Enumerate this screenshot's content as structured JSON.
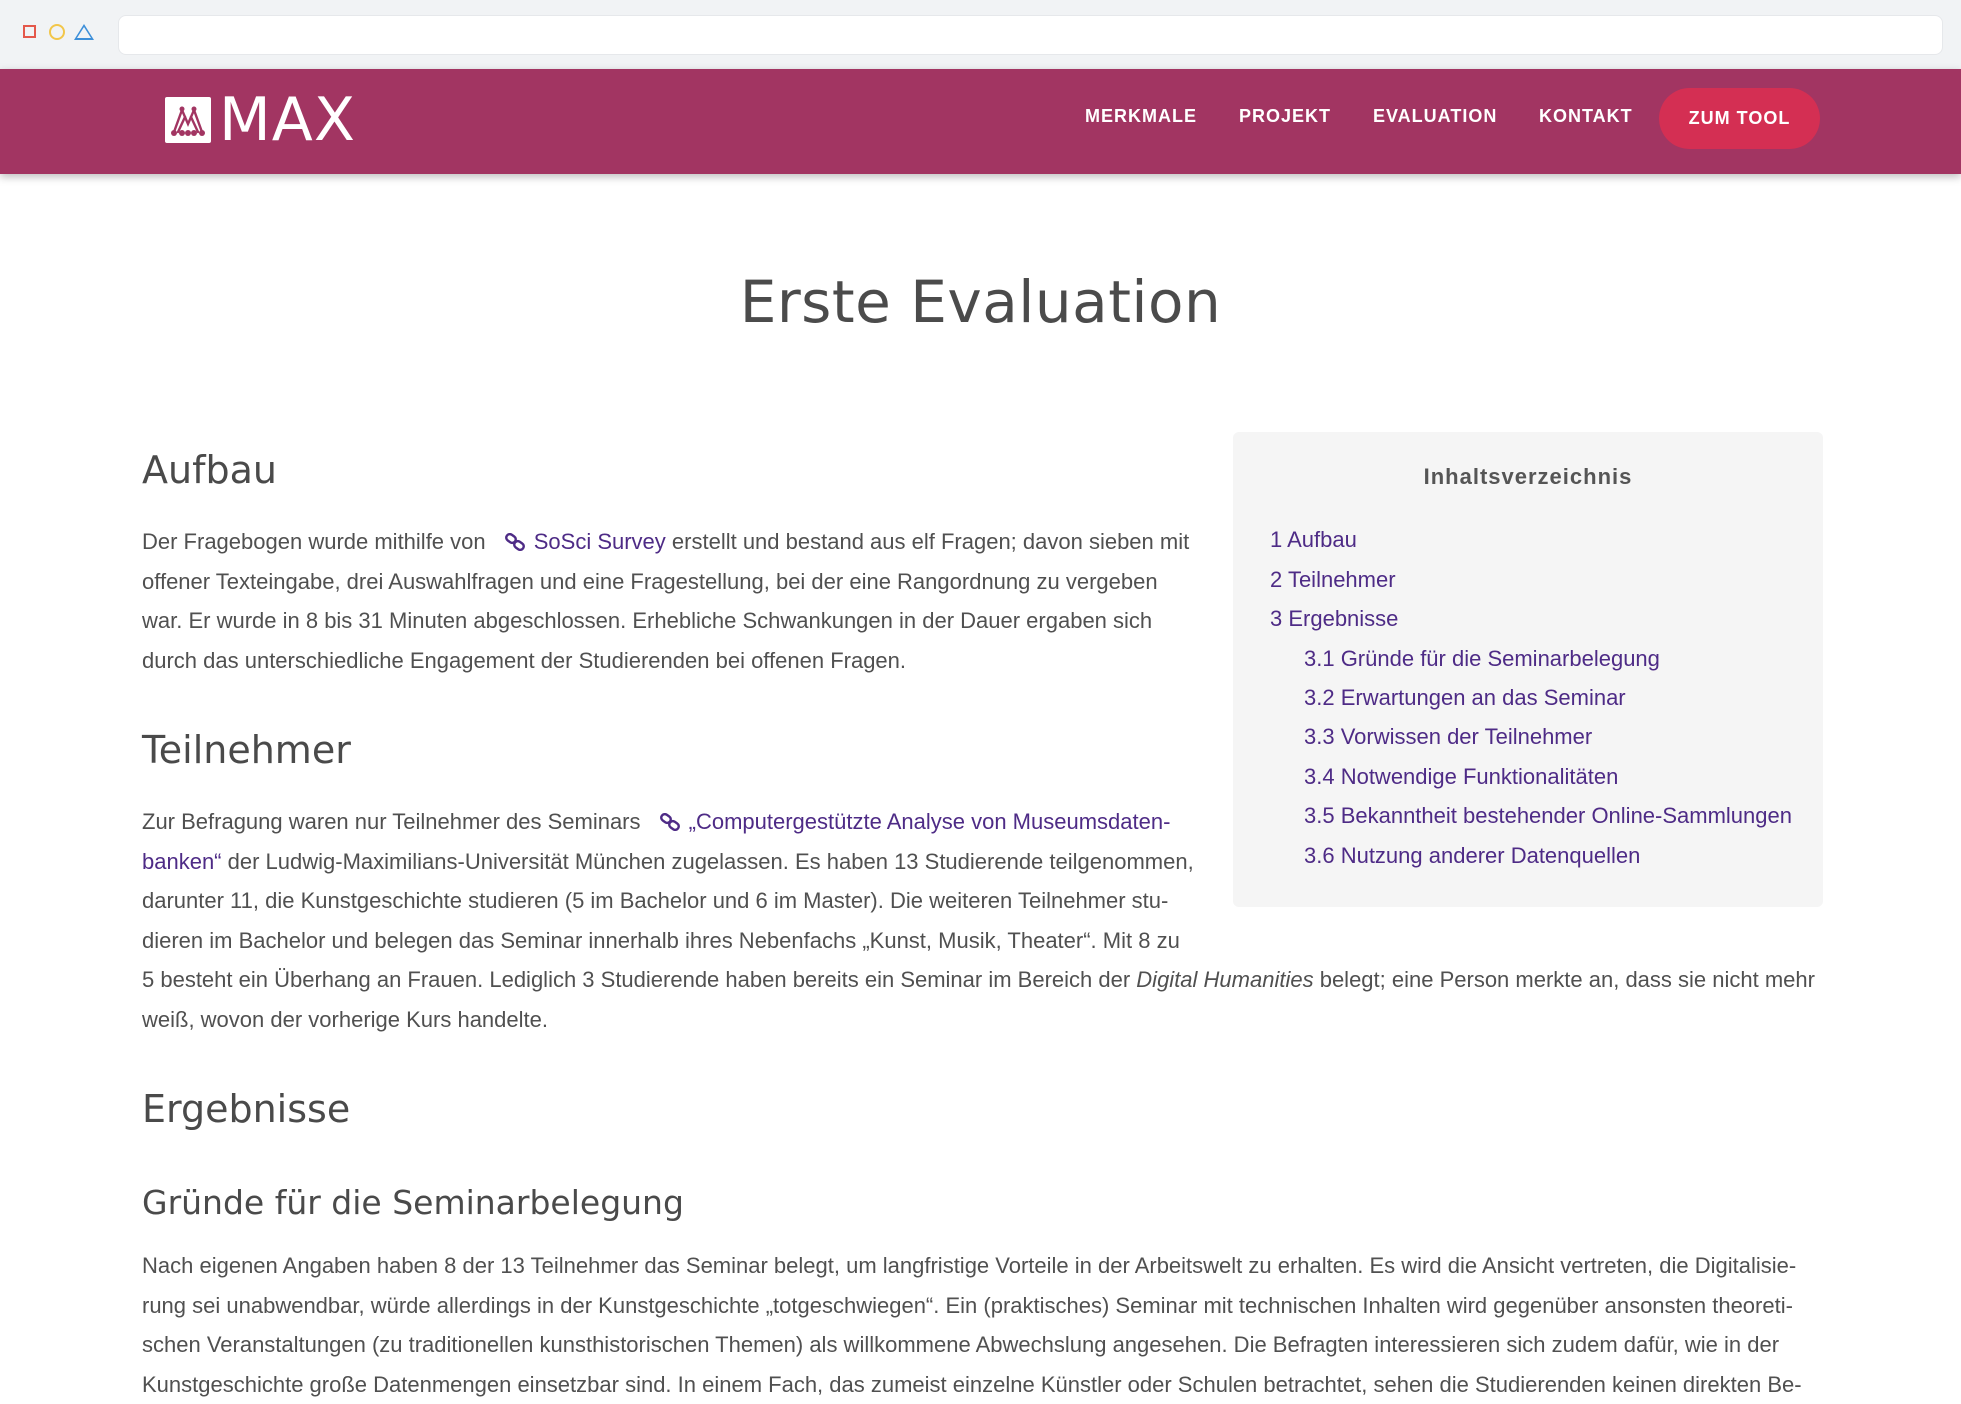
{
  "brand": {
    "name": "MAX",
    "primary_color": "#a23562",
    "cta_color": "#d42f53",
    "link_color": "#4e2b86"
  },
  "nav": {
    "items": [
      {
        "label": "MERKMALE"
      },
      {
        "label": "PROJEKT"
      },
      {
        "label": "EVALUATION"
      },
      {
        "label": "KONTAKT"
      }
    ],
    "cta_label": "ZUM TOOL"
  },
  "page": {
    "title": "Erste Evaluation"
  },
  "sections": {
    "aufbau": {
      "heading": "Aufbau",
      "text_before_link": "Der Fragebogen wurde mithilfe von ",
      "link": "SoSci Survey",
      "text_line1_after": " erstellt und bestand aus elf Fragen; davon sieben mit",
      "line2": "offener Texteingabe, drei Auswahlfragen und eine Fragestellung, bei der eine Rangordnung zu vergeben",
      "line3": "war. Er wurde in 8 bis 31 Minuten abgeschlossen. Erhebliche Schwankungen in der Dauer ergaben sich",
      "line4": "durch das unterschiedliche Engagement der Studierenden bei offenen Fragen."
    },
    "teilnehmer": {
      "heading": "Teilnehmer",
      "text_before_link": "Zur Befragung waren nur Teilnehmer des Seminars ",
      "link_line1": "„Computergestützte Analyse von Museumsdaten-",
      "link_line2": "banken“",
      "line2_after": " der Ludwig-Maximilians-Universität München zugelassen. Es haben 13 Studierende teilgenommen,",
      "line3": "darunter 11, die Kunstgeschichte studieren (5 im Bachelor und 6 im Master). Die weiteren Teilnehmer stu-",
      "line4": "dieren im Bachelor und belegen das Seminar innerhalb ihres Nebenfachs „Kunst, Musik, Theater“. Mit 8 zu",
      "line5_before": "5 besteht ein Überhang an Frauen. Lediglich 3 Studierende haben bereits ein Seminar im Bereich der ",
      "line5_italic": "Digital Humanities",
      "line5_after": " belegt; eine Person merkte an, dass sie nicht mehr",
      "line6": "weiß, wovon der vorherige Kurs handelte."
    },
    "ergebnisse": {
      "heading": "Ergebnisse",
      "sub_heading": "Gründe für die Seminarbelegung",
      "line1": "Nach eigenen Angaben haben 8 der 13 Teilnehmer das Seminar belegt, um langfristige Vorteile in der Arbeitswelt zu erhalten. Es wird die Ansicht vertreten, die Digitalisie-",
      "line2": "rung sei unabwendbar, würde allerdings in der Kunstgeschichte „totgeschwiegen“. Ein (praktisches) Seminar mit technischen Inhalten wird gegenüber ansonsten theoreti-",
      "line3": "schen Veranstaltungen (zu traditionellen kunsthistorischen Themen) als willkommene Abwechslung angesehen. Die Befragten interessieren sich zudem dafür, wie in der",
      "line4": "Kunstgeschichte große Datenmengen einsetzbar sind. In einem Fach, das zumeist einzelne Künstler oder Schulen betrachtet, sehen die Studierenden keinen direkten Be-"
    }
  },
  "toc": {
    "title": "Inhaltsverzeichnis",
    "items": [
      {
        "label": "1 Aufbau"
      },
      {
        "label": "2 Teilnehmer"
      },
      {
        "label": "3 Ergebnisse"
      },
      {
        "label": "3.1 Gründe für die Seminarbelegung"
      },
      {
        "label": "3.2 Erwartungen an das Seminar"
      },
      {
        "label": "3.3 Vorwissen der Teilnehmer"
      },
      {
        "label": "3.4 Notwendige Funktionalitäten"
      },
      {
        "label": "3.5 Bekanntheit bestehender Online-Sammlungen"
      },
      {
        "label": "3.6 Nutzung anderer Datenquellen"
      }
    ]
  }
}
